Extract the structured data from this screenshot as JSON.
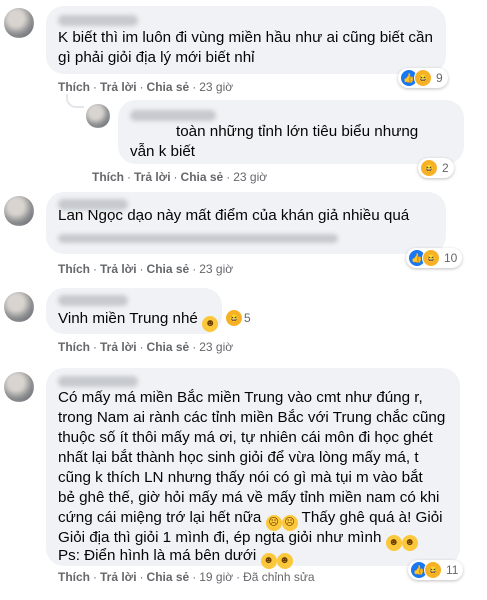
{
  "comments": [
    {
      "lines": [
        "K biết thì im luôn đi vùng miền hầu như ai cũng biết cần",
        "gì phải giỏi địa lý mới biết nhỉ"
      ],
      "actions": {
        "like": "Thích",
        "reply": "Trả lời",
        "share": "Chia sẻ",
        "time": "23 giờ"
      },
      "reaction_count": "9"
    },
    {
      "lines": [
        "toàn những tỉnh lớn tiêu biểu nhưng",
        "vẫn k biết"
      ],
      "actions": {
        "like": "Thích",
        "reply": "Trả lời",
        "share": "Chia sẻ",
        "time": "23 giờ"
      },
      "reaction_count": "2"
    },
    {
      "lines": [
        "Lan Ngọc dạo này mất điểm của khán giả nhiều quá"
      ],
      "actions": {
        "like": "Thích",
        "reply": "Trả lời",
        "share": "Chia sẻ",
        "time": "23 giờ"
      },
      "reaction_count": "10"
    },
    {
      "lines": [
        "Vinh miền Trung nhé"
      ],
      "inline_reaction_count": "5",
      "actions": {
        "like": "Thích",
        "reply": "Trả lời",
        "share": "Chia sẻ",
        "time": "23 giờ"
      }
    },
    {
      "lines": [
        "Có mấy má miền Bắc miền Trung vào cmt như đúng r,",
        "trong Nam ai rành các tỉnh miền Bắc với Trung chắc cũng",
        "thuộc số ít thôi mấy má ơi, tự nhiên cái môn đi học ghét",
        "nhất lại bắt thành học sinh giỏi để vừa lòng mấy má, t",
        "cũng k thích LN nhưng thấy nói có gì mà tụi m vào bắt",
        "bẻ ghê thế, giờ hỏi mấy má về mấy tỉnh miền nam có khi",
        "cứng cái miệng trớ lại hết nữa",
        "Giỏi địa thì giỏi 1 mình đi, ép ngta giỏi như mình",
        "Ps: Điển hình là má bên dưới"
      ],
      "line7_tail": "Thấy ghê quá à! Giỏi",
      "actions": {
        "like": "Thích",
        "reply": "Trả lời",
        "share": "Chia sẻ",
        "time": "19 giờ",
        "edited": "Đã chỉnh sửa"
      },
      "reaction_count": "11"
    }
  ]
}
